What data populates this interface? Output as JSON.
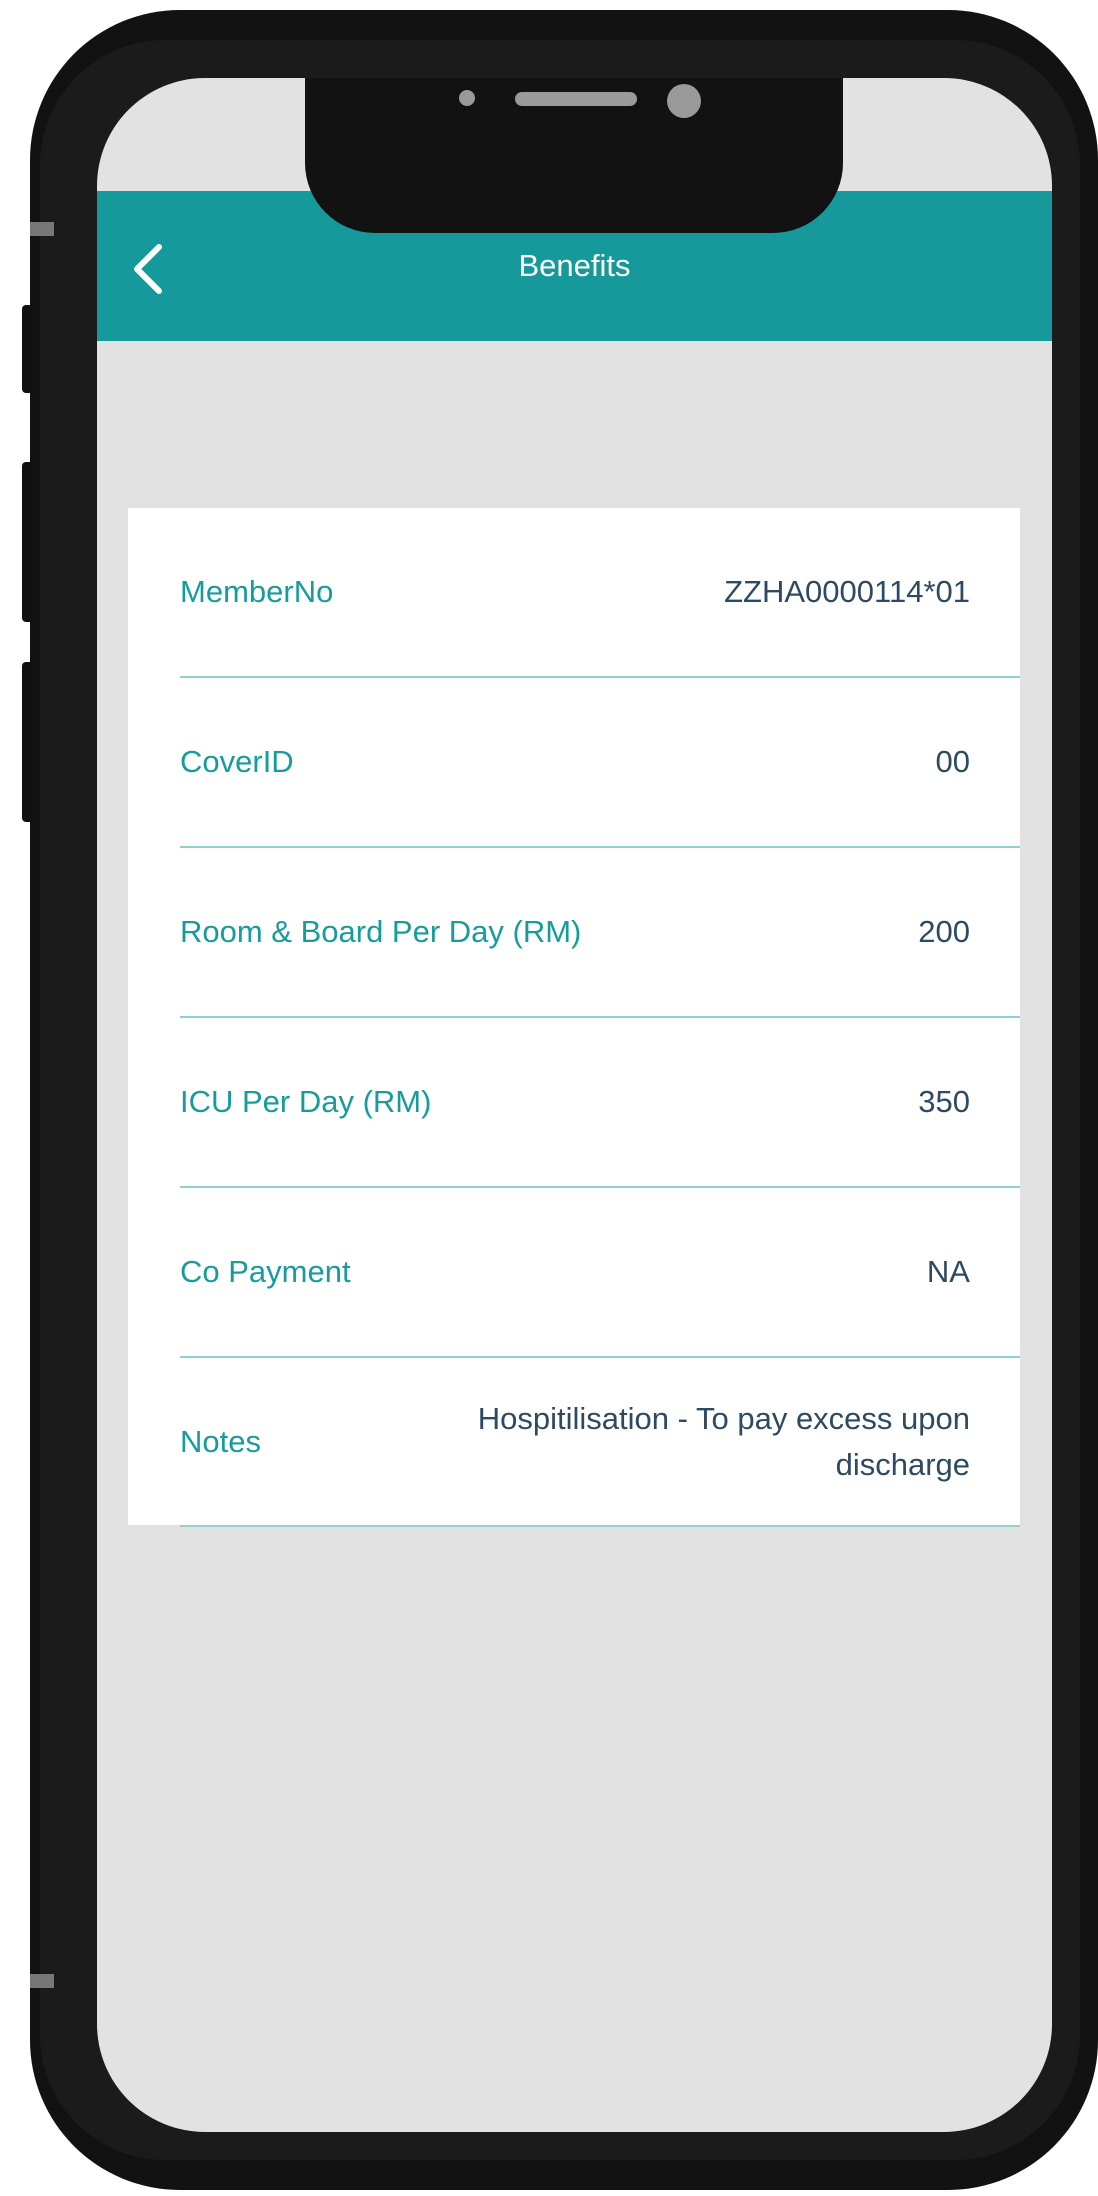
{
  "header": {
    "title": "Benefits"
  },
  "icons": {
    "back": "chevron-left-icon"
  },
  "colors": {
    "accent": "#16999a",
    "label": "#179c9c",
    "value": "#2e4a62",
    "divider": "#8fd0d3",
    "background": "#e2e2e2"
  },
  "benefits": [
    {
      "label": "MemberNo",
      "value": "ZZHA0000114*01"
    },
    {
      "label": "CoverID",
      "value": "00"
    },
    {
      "label": "Room & Board Per Day (RM)",
      "value": "200"
    },
    {
      "label": "ICU Per Day (RM)",
      "value": "350"
    },
    {
      "label": "Co Payment",
      "value": "NA"
    },
    {
      "label": "Notes",
      "value": "Hospitilisation - To pay excess upon discharge"
    }
  ]
}
